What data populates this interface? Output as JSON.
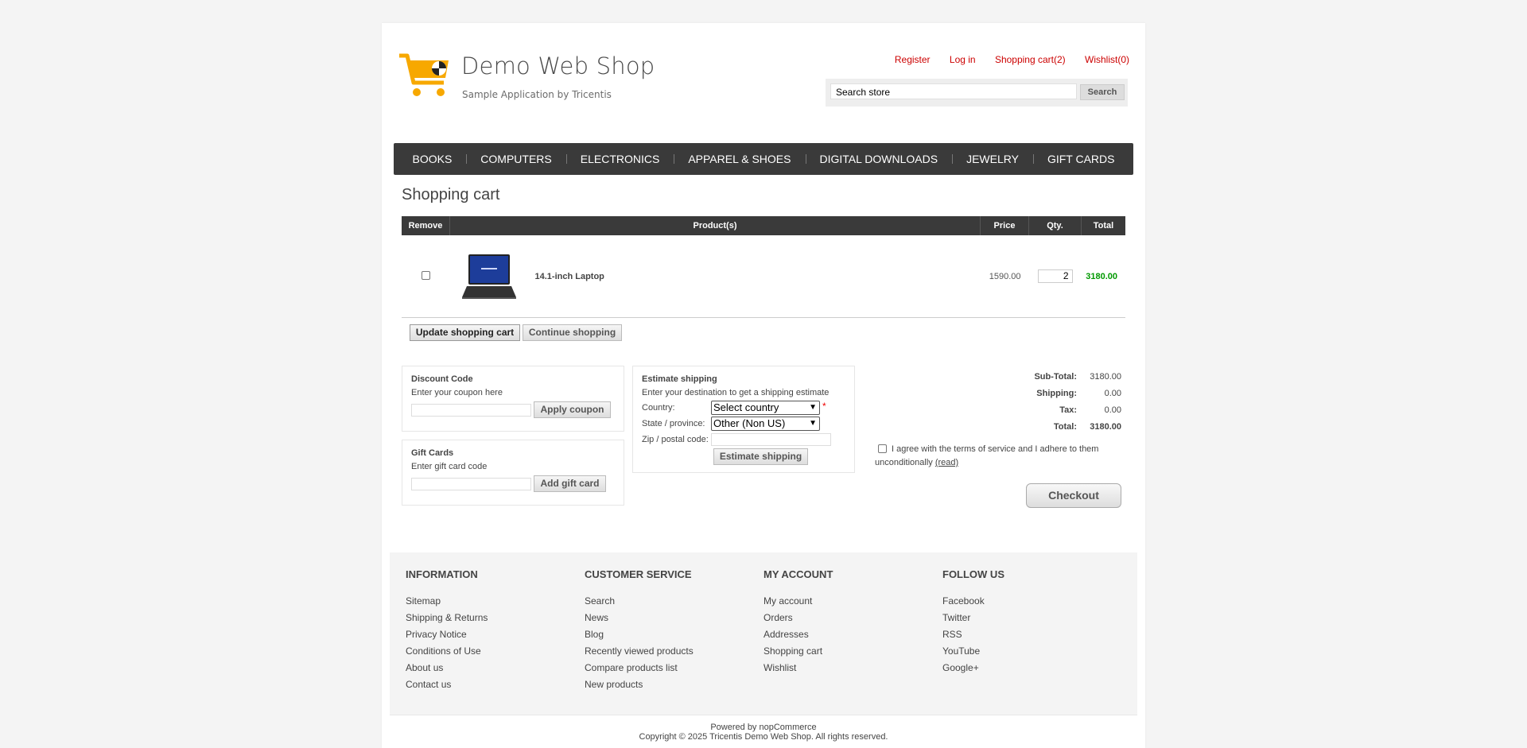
{
  "site": {
    "title": "Demo Web Shop",
    "subtitle": "Sample Application by Tricentis"
  },
  "header_links": {
    "register": "Register",
    "login": "Log in",
    "cart": "Shopping cart(2)",
    "wishlist": "Wishlist(0)"
  },
  "search": {
    "value": "Search store",
    "button": "Search"
  },
  "menu": [
    "BOOKS",
    "COMPUTERS",
    "ELECTRONICS",
    "APPAREL & SHOES",
    "DIGITAL DOWNLOADS",
    "JEWELRY",
    "GIFT CARDS"
  ],
  "page": {
    "title": "Shopping cart"
  },
  "cart_table": {
    "headers": {
      "remove": "Remove",
      "product": "Product(s)",
      "price": "Price",
      "qty": "Qty.",
      "total": "Total"
    },
    "rows": [
      {
        "name": "14.1-inch Laptop",
        "price": "1590.00",
        "qty": "2",
        "total": "3180.00"
      }
    ]
  },
  "buttons": {
    "update": "Update shopping cart",
    "continue": "Continue shopping",
    "apply_coupon": "Apply coupon",
    "add_gift_card": "Add gift card",
    "estimate": "Estimate shipping",
    "checkout": "Checkout"
  },
  "discount": {
    "title": "Discount Code",
    "hint": "Enter your coupon here"
  },
  "giftcards": {
    "title": "Gift Cards",
    "hint": "Enter gift card code"
  },
  "shipping": {
    "title": "Estimate shipping",
    "hint": "Enter your destination to get a shipping estimate",
    "country_label": "Country:",
    "country_value": "Select country",
    "state_label": "State / province:",
    "state_value": "Other (Non US)",
    "zip_label": "Zip / postal code:",
    "required_mark": "*"
  },
  "totals": {
    "subtotal_label": "Sub-Total:",
    "subtotal": "3180.00",
    "shipping_label": "Shipping:",
    "shipping": "0.00",
    "tax_label": "Tax:",
    "tax": "0.00",
    "total_label": "Total:",
    "total": "3180.00"
  },
  "terms": {
    "text": "I agree with the terms of service and I adhere to them unconditionally",
    "link": "(read)"
  },
  "footer": {
    "information": {
      "title": "INFORMATION",
      "links": [
        "Sitemap",
        "Shipping & Returns",
        "Privacy Notice",
        "Conditions of Use",
        "About us",
        "Contact us"
      ]
    },
    "customer_service": {
      "title": "CUSTOMER SERVICE",
      "links": [
        "Search",
        "News",
        "Blog",
        "Recently viewed products",
        "Compare products list",
        "New products"
      ]
    },
    "my_account": {
      "title": "MY ACCOUNT",
      "links": [
        "My account",
        "Orders",
        "Addresses",
        "Shopping cart",
        "Wishlist"
      ]
    },
    "follow_us": {
      "title": "FOLLOW US",
      "links": [
        "Facebook",
        "Twitter",
        "RSS",
        "YouTube",
        "Google+"
      ]
    }
  },
  "powered_by": "Powered by nopCommerce",
  "copyright": "Copyright © 2025 Tricentis Demo Web Shop. All rights reserved.",
  "colors": {
    "link_red": "#cc0000",
    "menu_bg": "#3a3a3a",
    "total_green": "#009900",
    "logo_orange": "#f7a800"
  }
}
